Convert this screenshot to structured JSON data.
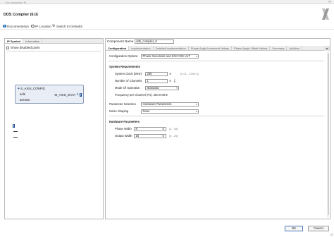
{
  "window": {
    "title": "Re-customize IP"
  },
  "app": {
    "title": "DDS Compiler (6.0)"
  },
  "toolbar": {
    "documentation": "Documentation",
    "ip_location": "IP Location",
    "switch_defaults": "Switch to Defaults"
  },
  "left_panel": {
    "tabs": [
      "IP Symbol",
      "Information"
    ],
    "show_disabled_ports": "Show disabled ports",
    "symbol": {
      "port_s_axis_config": "S_AXIS_CONFIG",
      "port_aclk": "aclk",
      "port_aresetn": "aresetn",
      "port_m_axis_data": "M_AXIS_DATA"
    }
  },
  "right_panel": {
    "component_name_label": "Component Name",
    "component_name_value": "dds_compiler_0",
    "tabs": [
      "Configuration",
      "Implementation",
      "Detailed Implementation",
      "Phase Angle Increment Values",
      "Phase Angle Offset Values",
      "Summary",
      "Addition"
    ],
    "configuration_options_label": "Configuration Options",
    "configuration_options_value": "Phase Generator and SIN COS LUT",
    "system_requirements": {
      "heading": "System Requirements",
      "system_clock_label": "System Clock (MHz)",
      "system_clock_value": "250",
      "system_clock_range": "[0.01 - 1000.0]",
      "num_channels_label": "Number of Channels",
      "num_channels_value": "1",
      "mode_label": "Mode Of Operation",
      "mode_value": "Standard",
      "freq_per_channel": "Frequency per Channel (Fs): 250.0 MHz"
    },
    "parameter_selection_label": "Parameter Selection",
    "parameter_selection_value": "Hardware Parameters",
    "noise_shaping_label": "Noise Shaping",
    "noise_shaping_value": "None",
    "hardware_parameters": {
      "heading": "Hardware Parameters",
      "phase_width_label": "Phase Width",
      "phase_width_value": "8",
      "phase_width_range": "[3 - 48]",
      "output_width_label": "Output Width",
      "output_width_value": "16",
      "output_width_range": "[6 - 26]"
    }
  },
  "footer": {
    "ok": "OK",
    "cancel": "Cancel"
  },
  "colors": {
    "accent": "#1f6fb5",
    "symbol_fill": "#e9eef6",
    "symbol_border": "#8a9bb5"
  }
}
